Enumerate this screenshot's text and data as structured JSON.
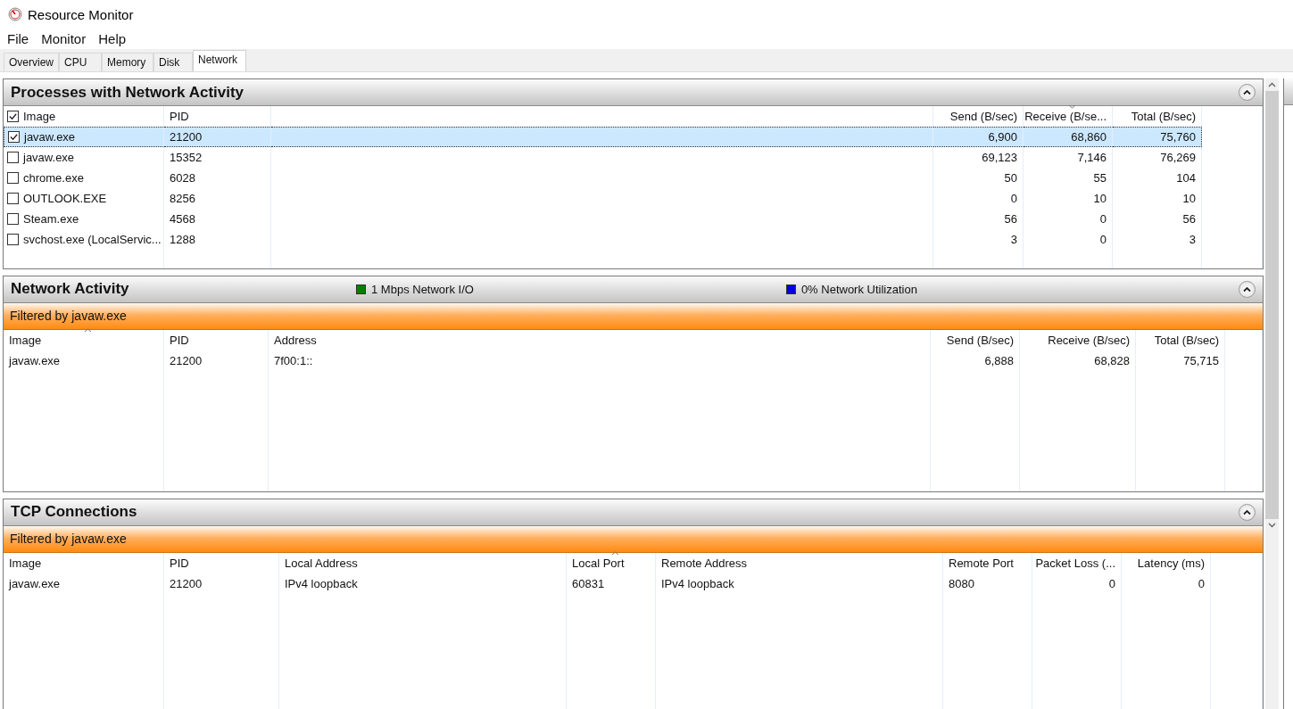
{
  "window": {
    "title": "Resource Monitor"
  },
  "menu": [
    "File",
    "Monitor",
    "Help"
  ],
  "tabs": [
    {
      "label": "Overview",
      "selected": false
    },
    {
      "label": "CPU",
      "selected": false
    },
    {
      "label": "Memory",
      "selected": false
    },
    {
      "label": "Disk",
      "selected": false
    },
    {
      "label": "Network",
      "selected": true
    }
  ],
  "panels": [
    {
      "title": "Processes with Network Activity",
      "kind": "checklist",
      "expanded": true,
      "header_checked": true,
      "columns": [
        {
          "label": "Image",
          "sort_up": false,
          "sort_down": false
        },
        {
          "label": "PID",
          "sort_up": false,
          "sort_down": false
        },
        {
          "label": "Send (B/sec)",
          "sort_up": false,
          "sort_down": false
        },
        {
          "label": "Receive (B/se...",
          "sort_up": false,
          "sort_down": true
        },
        {
          "label": "Total (B/sec)",
          "sort_up": false,
          "sort_down": false
        }
      ],
      "rows": [
        {
          "checked": true,
          "selected": true,
          "cells": [
            "javaw.exe",
            "21200",
            "6,900",
            "68,860",
            "75,760"
          ]
        },
        {
          "checked": false,
          "selected": false,
          "cells": [
            "javaw.exe",
            "15352",
            "69,123",
            "7,146",
            "76,269"
          ]
        },
        {
          "checked": false,
          "selected": false,
          "cells": [
            "chrome.exe",
            "6028",
            "50",
            "55",
            "104"
          ]
        },
        {
          "checked": false,
          "selected": false,
          "cells": [
            "OUTLOOK.EXE",
            "8256",
            "0",
            "10",
            "10"
          ]
        },
        {
          "checked": false,
          "selected": false,
          "cells": [
            "Steam.exe",
            "4568",
            "56",
            "0",
            "56"
          ]
        },
        {
          "checked": false,
          "selected": false,
          "cells": [
            "svchost.exe (LocalServic...",
            "1288",
            "3",
            "0",
            "3"
          ]
        }
      ]
    },
    {
      "title": "Network Activity",
      "kind": "activity",
      "expanded": true,
      "legend": [
        {
          "label": "1 Mbps Network I/O",
          "color": "#008000"
        },
        {
          "label": "0% Network Utilization",
          "color": "#0000e0"
        }
      ],
      "filter": "Filtered by javaw.exe",
      "columns": [
        {
          "label": "Image",
          "sort_up": true,
          "sort_down": false
        },
        {
          "label": "PID",
          "sort_up": false,
          "sort_down": false
        },
        {
          "label": "Address",
          "sort_up": false,
          "sort_down": false
        },
        {
          "label": "Send (B/sec)",
          "sort_up": false,
          "sort_down": false
        },
        {
          "label": "Receive (B/sec)",
          "sort_up": false,
          "sort_down": false
        },
        {
          "label": "Total (B/sec)",
          "sort_up": false,
          "sort_down": false
        }
      ],
      "rows": [
        {
          "selected": false,
          "cells": [
            "javaw.exe",
            "21200",
            "7f00:1::",
            "6,888",
            "68,828",
            "75,715"
          ]
        }
      ]
    },
    {
      "title": "TCP Connections",
      "kind": "connections",
      "expanded": true,
      "filter": "Filtered by javaw.exe",
      "columns": [
        {
          "label": "Image",
          "sort_up": false,
          "sort_down": false
        },
        {
          "label": "PID",
          "sort_up": false,
          "sort_down": false
        },
        {
          "label": "Local Address",
          "sort_up": false,
          "sort_down": false
        },
        {
          "label": "Local Port",
          "sort_up": true,
          "sort_down": false
        },
        {
          "label": "Remote Address",
          "sort_up": false,
          "sort_down": false
        },
        {
          "label": "Remote Port",
          "sort_up": false,
          "sort_down": false
        },
        {
          "label": "Packet Loss (...",
          "sort_up": false,
          "sort_down": false
        },
        {
          "label": "Latency (ms)",
          "sort_up": false,
          "sort_down": false
        }
      ],
      "rows": [
        {
          "selected": false,
          "cells": [
            "javaw.exe",
            "21200",
            "IPv4 loopback",
            "60831",
            "IPv4 loopback",
            "8080",
            "0",
            "0"
          ]
        }
      ]
    }
  ]
}
